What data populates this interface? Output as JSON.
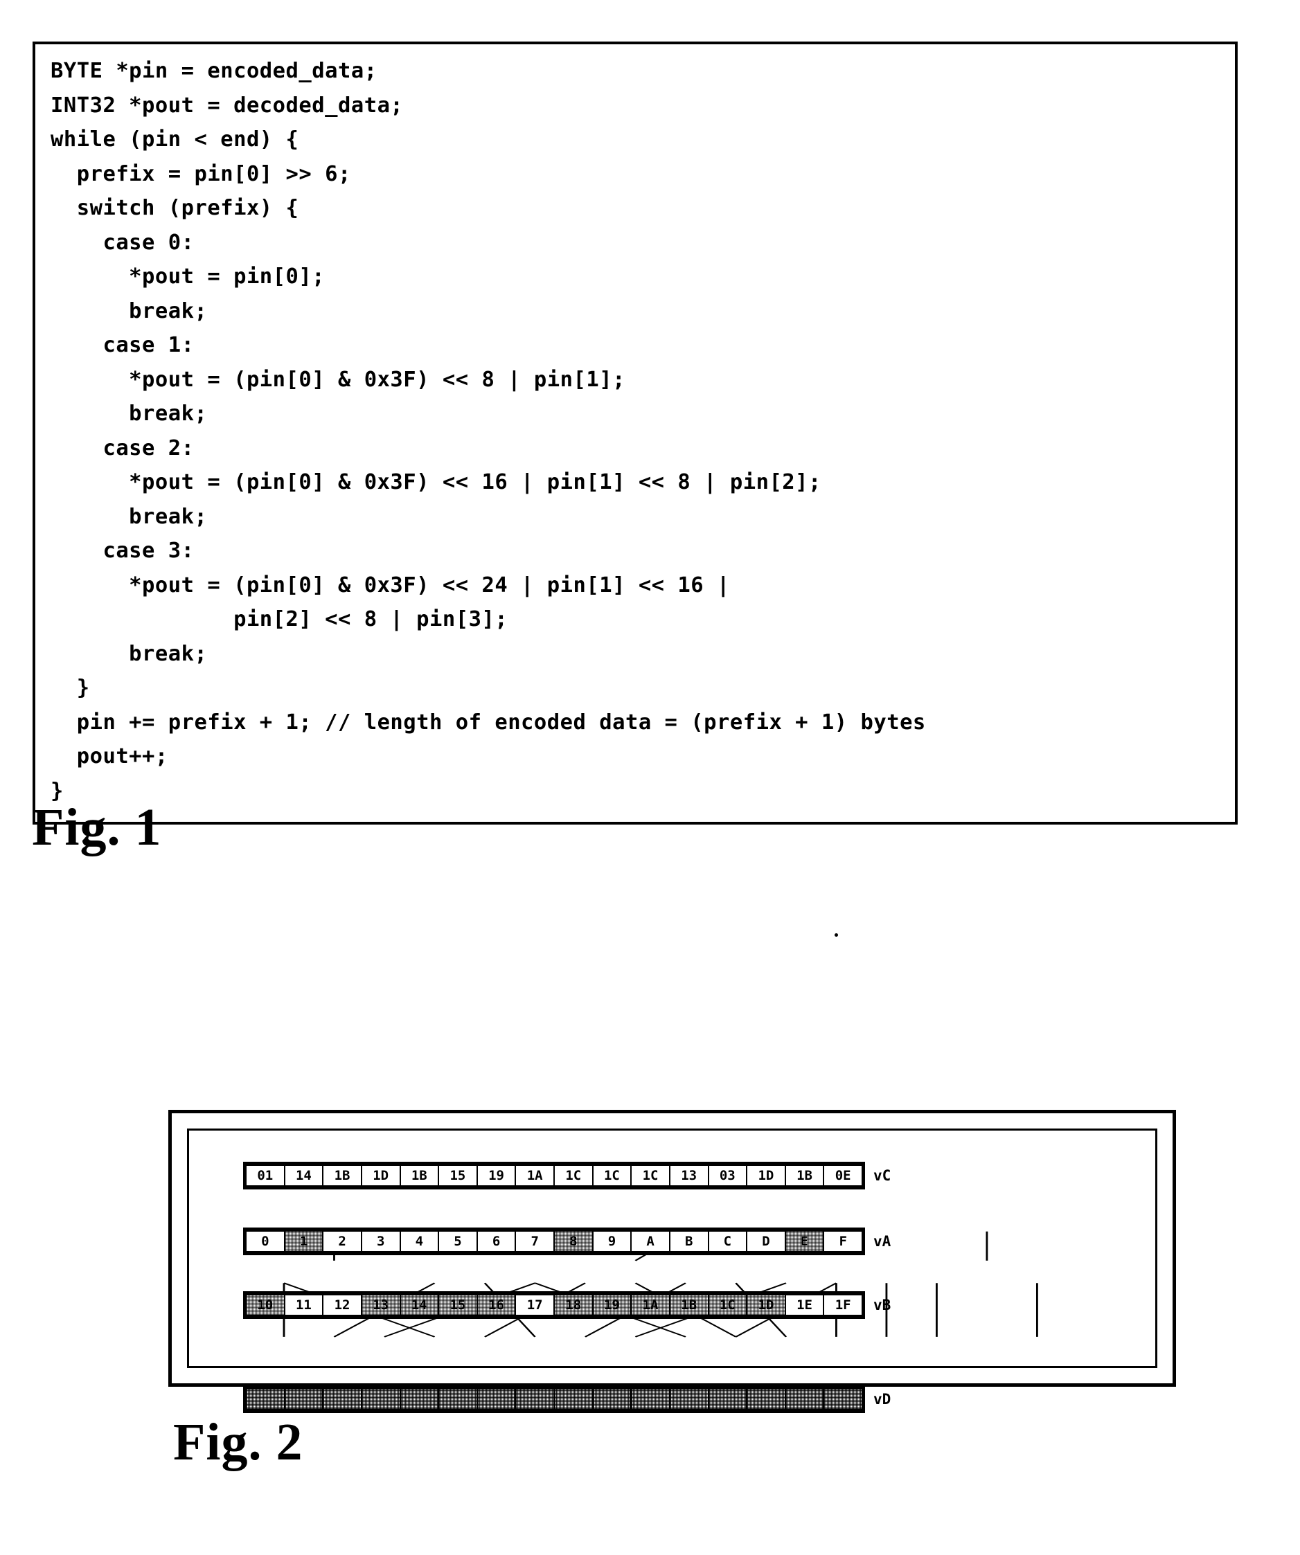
{
  "figure1": {
    "caption": "Fig. 1",
    "code": "BYTE *pin = encoded_data;\nINT32 *pout = decoded_data;\nwhile (pin < end) {\n  prefix = pin[0] >> 6;\n  switch (prefix) {\n    case 0:\n      *pout = pin[0];\n      break;\n    case 1:\n      *pout = (pin[0] & 0x3F) << 8 | pin[1];\n      break;\n    case 2:\n      *pout = (pin[0] & 0x3F) << 16 | pin[1] << 8 | pin[2];\n      break;\n    case 3:\n      *pout = (pin[0] & 0x3F) << 24 | pin[1] << 16 |\n              pin[2] << 8 | pin[3];\n      break;\n  }\n  pin += prefix + 1; // length of encoded data = (prefix + 1) bytes\n  pout++;\n}"
  },
  "figure2": {
    "caption": "Fig. 2",
    "rows": [
      {
        "label": "vC",
        "name": "row-vc",
        "cells": [
          {
            "text": "01",
            "style": "plain"
          },
          {
            "text": "14",
            "style": "plain"
          },
          {
            "text": "1B",
            "style": "plain"
          },
          {
            "text": "1D",
            "style": "plain"
          },
          {
            "text": "1B",
            "style": "plain"
          },
          {
            "text": "15",
            "style": "plain"
          },
          {
            "text": "19",
            "style": "plain"
          },
          {
            "text": "1A",
            "style": "plain"
          },
          {
            "text": "1C",
            "style": "plain"
          },
          {
            "text": "1C",
            "style": "plain"
          },
          {
            "text": "1C",
            "style": "plain"
          },
          {
            "text": "13",
            "style": "plain"
          },
          {
            "text": "03",
            "style": "plain"
          },
          {
            "text": "1D",
            "style": "plain"
          },
          {
            "text": "1B",
            "style": "plain"
          },
          {
            "text": "0E",
            "style": "plain"
          }
        ]
      },
      {
        "label": "vA",
        "name": "row-va",
        "cells": [
          {
            "text": "0",
            "style": "plain"
          },
          {
            "text": "1",
            "style": "shaded"
          },
          {
            "text": "2",
            "style": "plain"
          },
          {
            "text": "3",
            "style": "plain"
          },
          {
            "text": "4",
            "style": "plain"
          },
          {
            "text": "5",
            "style": "plain"
          },
          {
            "text": "6",
            "style": "plain"
          },
          {
            "text": "7",
            "style": "plain"
          },
          {
            "text": "8",
            "style": "shaded"
          },
          {
            "text": "9",
            "style": "plain"
          },
          {
            "text": "A",
            "style": "plain"
          },
          {
            "text": "B",
            "style": "plain"
          },
          {
            "text": "C",
            "style": "plain"
          },
          {
            "text": "D",
            "style": "plain"
          },
          {
            "text": "E",
            "style": "shaded"
          },
          {
            "text": "F",
            "style": "plain"
          }
        ]
      },
      {
        "label": "vB",
        "name": "row-vb",
        "cells": [
          {
            "text": "10",
            "style": "shaded"
          },
          {
            "text": "11",
            "style": "plain"
          },
          {
            "text": "12",
            "style": "plain"
          },
          {
            "text": "13",
            "style": "shaded"
          },
          {
            "text": "14",
            "style": "shaded"
          },
          {
            "text": "15",
            "style": "shaded"
          },
          {
            "text": "16",
            "style": "shaded"
          },
          {
            "text": "17",
            "style": "plain"
          },
          {
            "text": "18",
            "style": "shaded"
          },
          {
            "text": "19",
            "style": "shaded"
          },
          {
            "text": "1A",
            "style": "shaded"
          },
          {
            "text": "1B",
            "style": "shaded"
          },
          {
            "text": "1C",
            "style": "shaded"
          },
          {
            "text": "1D",
            "style": "shaded"
          },
          {
            "text": "1E",
            "style": "plain"
          },
          {
            "text": "1F",
            "style": "plain"
          }
        ]
      },
      {
        "label": "vD",
        "name": "row-vd",
        "cells": [
          {
            "text": "",
            "style": "noise"
          },
          {
            "text": "",
            "style": "noise"
          },
          {
            "text": "",
            "style": "noise"
          },
          {
            "text": "",
            "style": "noise"
          },
          {
            "text": "",
            "style": "noise"
          },
          {
            "text": "",
            "style": "noise"
          },
          {
            "text": "",
            "style": "noise"
          },
          {
            "text": "",
            "style": "noise"
          },
          {
            "text": "",
            "style": "noise"
          },
          {
            "text": "",
            "style": "noise"
          },
          {
            "text": "",
            "style": "noise"
          },
          {
            "text": "",
            "style": "noise"
          },
          {
            "text": "",
            "style": "noise"
          },
          {
            "text": "",
            "style": "noise"
          },
          {
            "text": "",
            "style": "noise"
          },
          {
            "text": "",
            "style": "noise"
          }
        ]
      }
    ],
    "connectors_va_to_vb": [
      {
        "from": 1,
        "to": 1
      },
      {
        "from": 8,
        "to": 7
      },
      {
        "from": 14,
        "to": 14
      }
    ],
    "connectors_vb_to_vd": [
      {
        "from": 0,
        "to": 0
      },
      {
        "from": 0,
        "to": 3
      },
      {
        "from": 3,
        "to": 1
      },
      {
        "from": 4,
        "to": 5
      },
      {
        "from": 5,
        "to": 2
      },
      {
        "from": 5,
        "to": 8
      },
      {
        "from": 6,
        "to": 4
      },
      {
        "from": 7,
        "to": 9
      },
      {
        "from": 8,
        "to": 6
      },
      {
        "from": 9,
        "to": 10
      },
      {
        "from": 10,
        "to": 7
      },
      {
        "from": 11,
        "to": 11
      },
      {
        "from": 11,
        "to": 9
      },
      {
        "from": 12,
        "to": 12
      },
      {
        "from": 13,
        "to": 13
      },
      {
        "from": 15,
        "to": 15
      }
    ]
  }
}
